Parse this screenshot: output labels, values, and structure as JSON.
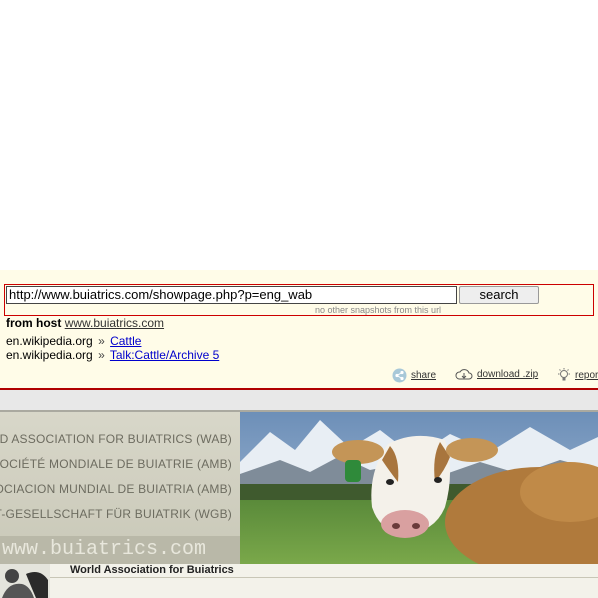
{
  "search": {
    "url_value": "http://www.buiatrics.com/showpage.php?p=eng_wab",
    "button_label": "search",
    "snapshot_note": "no other snapshots from this url"
  },
  "from_host": {
    "label": "from host",
    "host": "www.buiatrics.com"
  },
  "references": [
    {
      "domain": "en.wikipedia.org",
      "separator": "»",
      "link": "Cattle"
    },
    {
      "domain": "en.wikipedia.org",
      "separator": "»",
      "link": "Talk:Cattle/Archive 5"
    }
  ],
  "actions": {
    "share": "share",
    "download": "download .zip",
    "report": "report"
  },
  "banner": {
    "lines": [
      "WORLD ASSOCIATION FOR BUIATRICS (WAB)",
      "SOCIÉTÉ MONDIALE DE BUIATRIE (AMB)",
      "ASOCIACION MUNDIAL DE BUIATRIA (AMB)",
      "WELT-GESELLSCHAFT FÜR BUIATRIK (WGB)"
    ],
    "url_text": "www.buiatrics.com"
  },
  "footer": {
    "title": "World Association for Buiatrics"
  },
  "colors": {
    "archive_bg": "#fffce8",
    "accent_red": "#cc0000",
    "link_blue": "#0000cc"
  }
}
